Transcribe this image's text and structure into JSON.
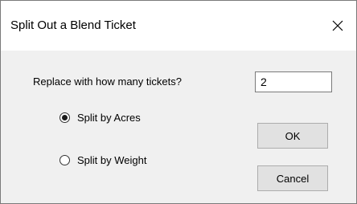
{
  "window": {
    "title": "Split Out a Blend Ticket",
    "close_glyph": "×"
  },
  "form": {
    "count_label": "Replace with how many tickets?",
    "count_value": "2",
    "split_options": [
      {
        "label": "Split by Acres",
        "selected": true
      },
      {
        "label": "Split by Weight",
        "selected": false
      }
    ]
  },
  "buttons": {
    "ok_label": "OK",
    "cancel_label": "Cancel"
  },
  "icons": {
    "close": "close-icon",
    "radio_selected": "radio-selected-icon",
    "radio_unselected": "radio-unselected-icon"
  }
}
